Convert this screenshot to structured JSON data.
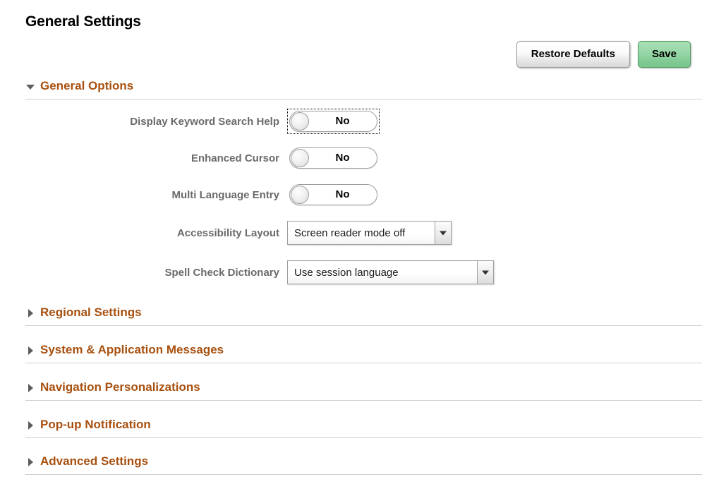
{
  "page": {
    "title": "General Settings"
  },
  "colors": {
    "section_title": "#a8500f",
    "label": "#6a6a6a",
    "save_button_bg": "#97d7a7",
    "save_button_border": "#4e9b62",
    "divider": "#cfcfcf"
  },
  "toolbar": {
    "restore_defaults_label": "Restore Defaults",
    "save_label": "Save"
  },
  "sections": [
    {
      "id": "general-options",
      "title": "General Options",
      "expanded": true,
      "icon": "chevron-down-icon"
    },
    {
      "id": "regional-settings",
      "title": "Regional Settings",
      "expanded": false,
      "icon": "chevron-right-icon"
    },
    {
      "id": "system-application-messages",
      "title": "System & Application Messages",
      "expanded": false,
      "icon": "chevron-right-icon"
    },
    {
      "id": "navigation-personalizations",
      "title": "Navigation Personalizations",
      "expanded": false,
      "icon": "chevron-right-icon"
    },
    {
      "id": "pop-up-notification",
      "title": "Pop-up Notification",
      "expanded": false,
      "icon": "chevron-right-icon"
    },
    {
      "id": "advanced-settings",
      "title": "Advanced Settings",
      "expanded": false,
      "icon": "chevron-right-icon"
    }
  ],
  "general_options": {
    "fields": [
      {
        "id": "display-keyword-search-help",
        "label": "Display Keyword Search Help",
        "type": "toggle",
        "value": "No",
        "focused": true
      },
      {
        "id": "enhanced-cursor",
        "label": "Enhanced Cursor",
        "type": "toggle",
        "value": "No",
        "focused": false
      },
      {
        "id": "multi-language-entry",
        "label": "Multi Language Entry",
        "type": "toggle",
        "value": "No",
        "focused": false
      },
      {
        "id": "accessibility-layout",
        "label": "Accessibility Layout",
        "type": "dropdown",
        "value": "Screen reader mode off"
      },
      {
        "id": "spell-check-dictionary",
        "label": "Spell Check Dictionary",
        "type": "dropdown",
        "value": "Use session language"
      }
    ]
  }
}
